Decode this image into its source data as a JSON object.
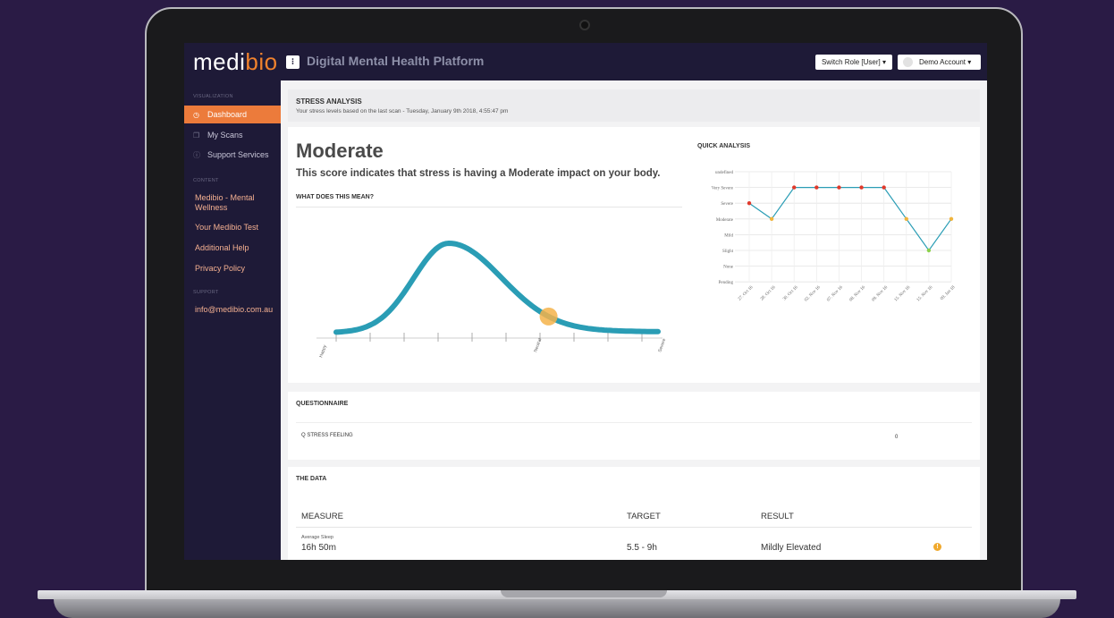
{
  "brand": {
    "logo_prefix": "medi",
    "logo_accent": "bio"
  },
  "header": {
    "platform_title": "Digital Mental Health Platform",
    "switch_role_label": "Switch Role [User] ▾",
    "account_label": "Demo Account ▾"
  },
  "sidebar": {
    "visualization_label": "VISUALIZATION",
    "items": [
      {
        "label": "Dashboard",
        "icon": "dashboard-icon",
        "active": true
      },
      {
        "label": "My Scans",
        "icon": "scans-icon"
      },
      {
        "label": "Support Services",
        "icon": "info-icon"
      }
    ],
    "content_label": "CONTENT",
    "content_links": [
      "Medibio - Mental Wellness",
      "Your Medibio Test",
      "Additional Help",
      "Privacy Policy"
    ],
    "support_label": "SUPPORT",
    "support_email": "info@medibio.com.au"
  },
  "stress": {
    "title": "STRESS ANALYSIS",
    "subtitle": "Your stress levels based on the last scan - Tuesday, January 9th 2018, 4:55:47 pm",
    "level": "Moderate",
    "description": "This score indicates that stress is having a Moderate impact on your body.",
    "meaning_label": "WHAT DOES THIS MEAN?",
    "bell_labels": [
      "Happy",
      "Neutral",
      "Severe"
    ],
    "marker_position": 0.66
  },
  "chart_data": {
    "type": "line",
    "title": "QUICK ANALYSIS",
    "y_categories": [
      "Pending",
      "None",
      "Slight",
      "Mild",
      "Moderate",
      "Severe",
      "Very Severe",
      "undefined"
    ],
    "x": [
      "27. Oct 16",
      "28. Oct 16",
      "30. Oct 16",
      "02. Nov 16",
      "07. Nov 16",
      "08. Nov 16",
      "09. Nov 16",
      "15. Nov 16",
      "15. Nov 16",
      "09. Jan 18"
    ],
    "values": [
      "Severe",
      "Moderate",
      "Very Severe",
      "Very Severe",
      "Very Severe",
      "Very Severe",
      "Very Severe",
      "Moderate",
      "Slight",
      "Moderate"
    ],
    "colors": {
      "line": "#2a9db5",
      "severe": "#e0392b",
      "moderate": "#f0b43c",
      "slight": "#8bd14b"
    },
    "grid": true
  },
  "questionnaire": {
    "title": "QUESTIONNAIRE",
    "item": "Q STRESS FEELING",
    "value": "0"
  },
  "data_table": {
    "title": "THE DATA",
    "headers": [
      "MEASURE",
      "TARGET",
      "RESULT"
    ],
    "row": {
      "small_label": "Average Sleep",
      "measure": "16h 50m",
      "target": "5.5 - 9h",
      "result": "Mildly Elevated"
    }
  },
  "colors": {
    "accent": "#ec7b3b",
    "nav_bg": "#1e1a37",
    "curve": "#2a9db5",
    "marker": "#f5b34a"
  }
}
